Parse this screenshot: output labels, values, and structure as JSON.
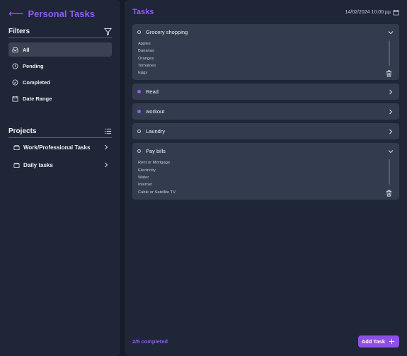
{
  "sidebar": {
    "title": "Personal Tasks",
    "filters_title": "Filters",
    "filters": [
      {
        "label": "All",
        "icon": "inbox-icon",
        "active": true
      },
      {
        "label": "Pending",
        "icon": "clock-icon",
        "active": false
      },
      {
        "label": "Completed",
        "icon": "check-circle-icon",
        "active": false
      },
      {
        "label": "Date Range",
        "icon": "calendar-icon",
        "active": false
      }
    ],
    "projects_title": "Projects",
    "projects": [
      {
        "label": "Work/Professional Tasks",
        "icon": "folder-icon"
      },
      {
        "label": "Daily tasks",
        "icon": "folder-icon"
      }
    ]
  },
  "main": {
    "title": "Tasks",
    "datetime": "14/02/2024 10:00 µµ",
    "tasks": [
      {
        "label": "Grocery shopping",
        "completed": false,
        "expanded": true,
        "subtasks": [
          "Apples",
          "Bananas",
          "Oranges",
          "Tomatoes",
          "Eggs"
        ]
      },
      {
        "label": "Read",
        "completed": true,
        "expanded": false
      },
      {
        "label": "workout",
        "completed": true,
        "expanded": false
      },
      {
        "label": "Laundry",
        "completed": false,
        "expanded": false
      },
      {
        "label": "Pay bills",
        "completed": false,
        "expanded": true,
        "subtasks": [
          "Rent or Mortgage",
          "Electricity",
          "Water",
          "Internet",
          "Cable or Satellite TV"
        ]
      }
    ],
    "progress": "2/5 completed",
    "add_task_label": "Add Task"
  },
  "colors": {
    "accent": "#8f5bf0",
    "panel": "#1f2637",
    "card": "#333c4e",
    "background": "#151b27"
  }
}
